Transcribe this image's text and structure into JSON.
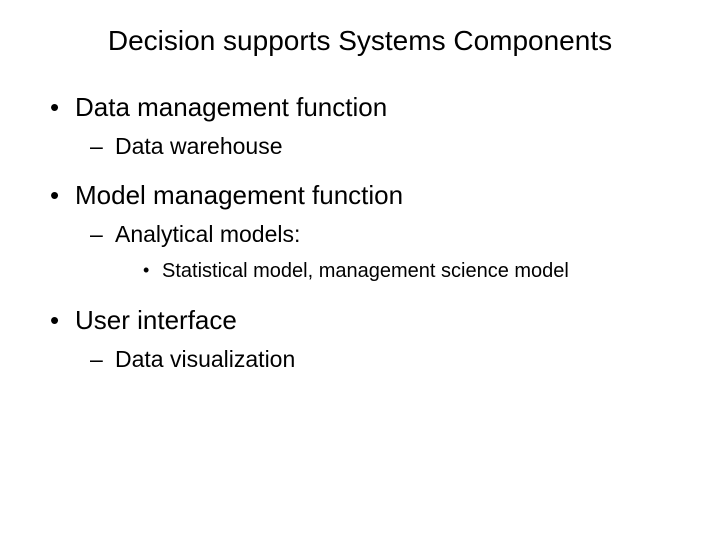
{
  "slide": {
    "title": "Decision supports Systems Components",
    "items": [
      {
        "text": "Data management function",
        "sub": [
          {
            "text": "Data warehouse",
            "sub": []
          }
        ]
      },
      {
        "text": "Model management function",
        "sub": [
          {
            "text": "Analytical models:",
            "sub": [
              {
                "text": "Statistical model, management science model"
              }
            ]
          }
        ]
      },
      {
        "text": "User interface",
        "sub": [
          {
            "text": "Data visualization",
            "sub": []
          }
        ]
      }
    ]
  }
}
